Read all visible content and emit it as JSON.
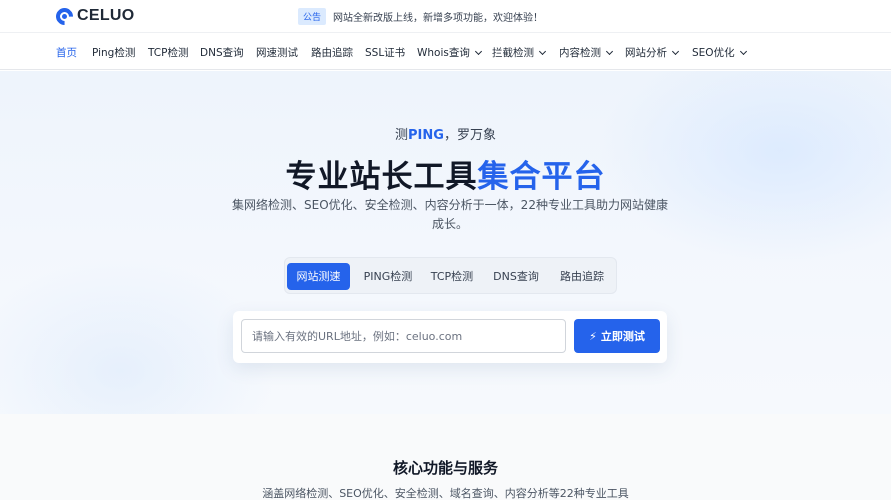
{
  "brand": {
    "logo_text": "CELUO",
    "accent": "#2563eb"
  },
  "notice": {
    "badge": "公告",
    "text": "网站全新改版上线，新增多项功能，欢迎体验！"
  },
  "nav": {
    "items": [
      {
        "label": "首页",
        "active": true,
        "dropdown": false
      },
      {
        "label": "Ping检测",
        "dropdown": false
      },
      {
        "label": "TCP检测",
        "dropdown": false
      },
      {
        "label": "DNS查询",
        "dropdown": false
      },
      {
        "label": "网速测试",
        "dropdown": false
      },
      {
        "label": "路由追踪",
        "dropdown": false
      },
      {
        "label": "SSL证书",
        "dropdown": false
      },
      {
        "label": "Whois查询",
        "dropdown": true
      },
      {
        "label": "拦截检测",
        "dropdown": true
      },
      {
        "label": "内容检测",
        "dropdown": true
      },
      {
        "label": "网站分析",
        "dropdown": true
      },
      {
        "label": "SEO优化",
        "dropdown": true
      }
    ]
  },
  "hero": {
    "tagline_prefix": "测",
    "tagline_highlight": "PING",
    "tagline_suffix": "，罗万象",
    "title_main": "专业站长工具",
    "title_accent": "集合平台",
    "description": "集网络检测、SEO优化、安全检测、内容分析于一体，22种专业工具助力网站健康成长。"
  },
  "tool_tabs": [
    {
      "label": "网站测速",
      "active": true
    },
    {
      "label": "PING检测"
    },
    {
      "label": "TCP检测"
    },
    {
      "label": "DNS查询"
    },
    {
      "label": "路由追踪"
    }
  ],
  "search": {
    "placeholder": "请输入有效的URL地址，例如：celuo.com",
    "value": "",
    "button_icon": "bolt-icon",
    "button_label": "立即测试"
  },
  "features": {
    "title": "核心功能与服务",
    "subtitle": "涵盖网络检测、SEO优化、安全检测、域名查询、内容分析等22种专业工具"
  }
}
